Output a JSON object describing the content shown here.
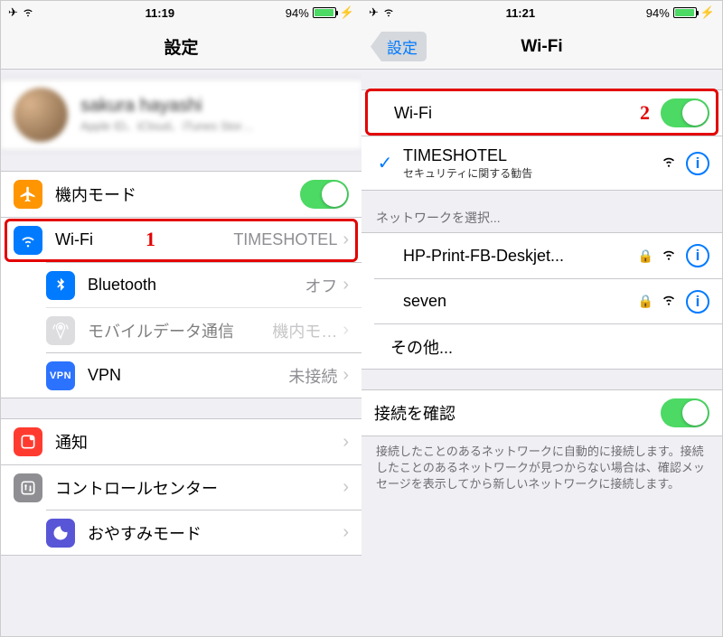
{
  "left": {
    "status": {
      "time": "11:19",
      "battery": "94%"
    },
    "title": "設定",
    "profile": {
      "name": "sakura hayashi",
      "desc": "Apple ID、iCloud、iTunes Stor…"
    },
    "rows": {
      "airplane": {
        "label": "機内モード"
      },
      "wifi": {
        "label": "Wi-Fi",
        "value": "TIMESHOTEL"
      },
      "bluetooth": {
        "label": "Bluetooth",
        "value": "オフ"
      },
      "cellular": {
        "label": "モバイルデータ通信",
        "value": "機内モ…"
      },
      "vpn": {
        "label": "VPN",
        "value": "未接続",
        "icon": "VPN"
      },
      "notifications": {
        "label": "通知"
      },
      "control": {
        "label": "コントロールセンター"
      },
      "dnd": {
        "label": "おやすみモード"
      }
    },
    "annotation": "1"
  },
  "right": {
    "status": {
      "time": "11:21",
      "battery": "94%"
    },
    "back": "設定",
    "title": "Wi-Fi",
    "wifi_toggle_label": "Wi-Fi",
    "connected": {
      "name": "TIMESHOTEL",
      "warning": "セキュリティに関する勧告"
    },
    "section_choose": "ネットワークを選択...",
    "networks": [
      {
        "name": "HP-Print-FB-Deskjet...",
        "locked": true
      },
      {
        "name": "seven",
        "locked": true
      }
    ],
    "other": "その他...",
    "ask_label": "接続を確認",
    "footer": "接続したことのあるネットワークに自動的に接続します。接続したことのあるネットワークが見つからない場合は、確認メッセージを表示してから新しいネットワークに接続します。",
    "annotation": "2"
  }
}
